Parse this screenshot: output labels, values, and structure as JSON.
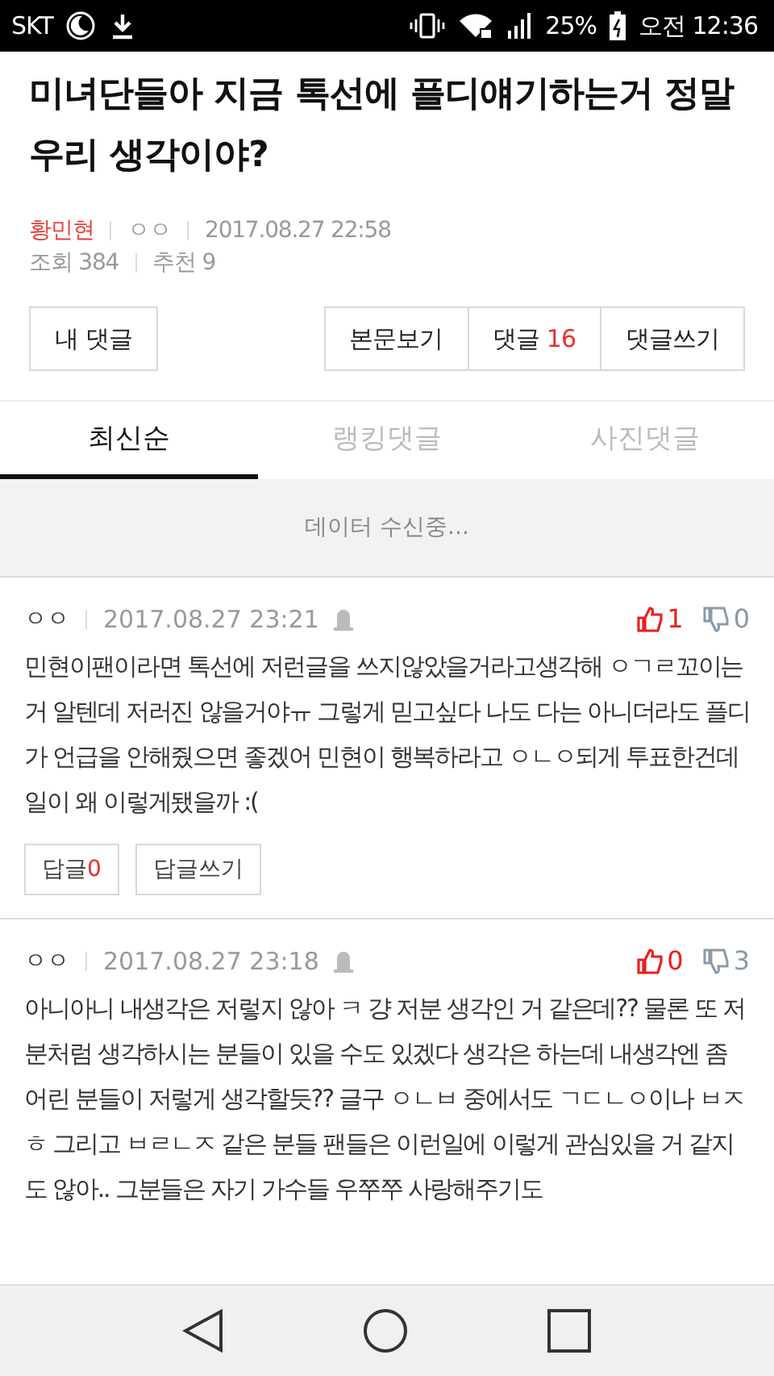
{
  "status_bar": {
    "carrier": "SKT",
    "battery": "25%",
    "time": "오전 12:36"
  },
  "article": {
    "title": "미녀단들아 지금 톡선에 플디얘기하는거 정말 우리 생각이야?",
    "author": "황민현",
    "nickname": "ㅇㅇ",
    "date": "2017.08.27 22:58",
    "views": "조회 384",
    "recommends": "추천 9"
  },
  "actions": {
    "my_comments": "내 댓글",
    "view_post": "본문보기",
    "comments_label": "댓글",
    "comments_count": "16",
    "write_comment": "댓글쓰기"
  },
  "tabs": [
    {
      "label": "최신순",
      "selected": true
    },
    {
      "label": "랭킹댓글",
      "selected": false
    },
    {
      "label": "사진댓글",
      "selected": false
    }
  ],
  "loading": "데이터 수신중...",
  "comments": [
    {
      "nickname": "ㅇㅇ",
      "date": "2017.08.27 23:21",
      "likes": "1",
      "dislikes": "0",
      "text": "민현이팬이라면 톡선에 저런글을 쓰지않았을거라고생각해 ㅇㄱㄹ꼬이는거 알텐데 저러진 않을거야ㅠ 그렇게 믿고싶다 나도 다는 아니더라도 플디가 언급을 안해줬으면 좋겠어 민현이 행복하라고 ㅇㄴㅇ되게 투표한건데 일이 왜 이렇게됐을까 :(",
      "reply_label": "답글",
      "reply_count": "0",
      "write_reply": "답글쓰기"
    },
    {
      "nickname": "ㅇㅇ",
      "date": "2017.08.27 23:18",
      "likes": "0",
      "dislikes": "3",
      "text": "아니아니 내생각은 저렇지 않아 ㅋ 걍 저분 생각인 거 같은데?? 물론 또 저분처럼 생각하시는 분들이 있을 수도 있겠다 생각은 하는데 내생각엔 좀 어린 분들이 저렇게 생각할듯?? 글구 ㅇㄴㅂ 중에서도 ㄱㄷㄴㅇ이나 ㅂㅈㅎ 그리고 ㅂㄹㄴㅈ 같은 분들 팬들은 이런일에 이렇게 관심있을 거 같지도 않아.. 그분들은 자기 가수들 우쭈쭈 사랑해주기도"
    }
  ]
}
